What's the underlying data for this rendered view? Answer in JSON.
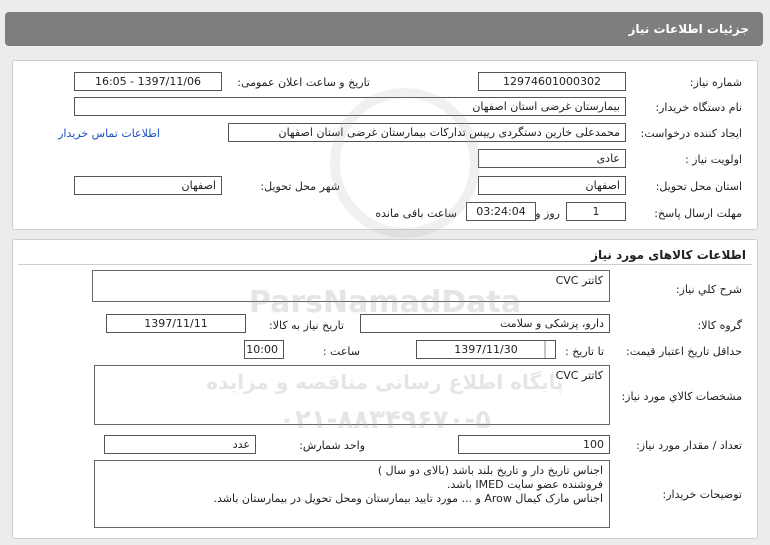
{
  "header": {
    "title": "جزئیات اطلاعات نیاز"
  },
  "need_info": {
    "need_number_label": "شماره نیاز:",
    "need_number": "12974601000302",
    "announce_label": "تاریخ و ساعت اعلان عمومی:",
    "announce_value": "1397/11/06 - 16:05",
    "buyer_label": "نام دستگاه خریدار:",
    "buyer_value": "بیمارستان غرضی استان اصفهان",
    "creator_label": "ایجاد کننده درخواست:",
    "creator_value": "محمدعلی خارین دستگردی رییس تدارکات بیمارستان غرضی استان اصفهان",
    "contact_link": "اطلاعات تماس خریدار",
    "priority_label": "اولویت نیاز :",
    "priority_value": "عادی",
    "province_label": "استان محل تحویل:",
    "province_value": "اصفهان",
    "city_label": "شهر محل تحویل:",
    "city_value": "اصفهان",
    "deadline_label": "مهلت ارسال پاسخ:",
    "deadline_days": "1",
    "days_word": "روز و",
    "deadline_time": "03:24:04",
    "remaining_word": "ساعت باقی مانده"
  },
  "goods": {
    "section_title": "اطلاعات کالاهای مورد نیاز",
    "summary_label": "شرح کلي نیاز:",
    "summary_value": "کاتتر CVC",
    "group_label": "گروه کالا:",
    "group_value": "دارو، پزشکی و سلامت",
    "need_date_label": "تاریخ نیاز به کالا:",
    "need_date_value": "1397/11/11",
    "validity_label": "حداقل تاریخ اعتبار قیمت:",
    "until_date_label": "تا تاریخ :",
    "until_date_value": "1397/11/30",
    "hour_label": "ساعت :",
    "hour_value": "10:00",
    "spec_label": "مشخصات کالاي مورد نیاز:",
    "spec_value": "کاتتر CVC",
    "qty_label": "تعداد / مقدار مورد نیاز:",
    "qty_value": "100",
    "unit_label": "واحد شمارش:",
    "unit_value": "عدد",
    "desc_label": "توضیحات خریدار:",
    "desc_value": "اجناس تاریخ دار و تاریخ بلند باشد (بالای دو سال )\nفروشنده عضو سایت IMED باشد.\nاجناس مارک کیمال Arow و ... مورد تایید بیمارستان ومحل تحویل در بیمارستان باشد."
  },
  "watermark": {
    "brand": "ParsNamadData",
    "line1": "پایگاه اطلاع رسانی مناقصه و مزایده",
    "line2": "۰۲۱-۸۸۳۴۹۶۷۰-۵"
  }
}
